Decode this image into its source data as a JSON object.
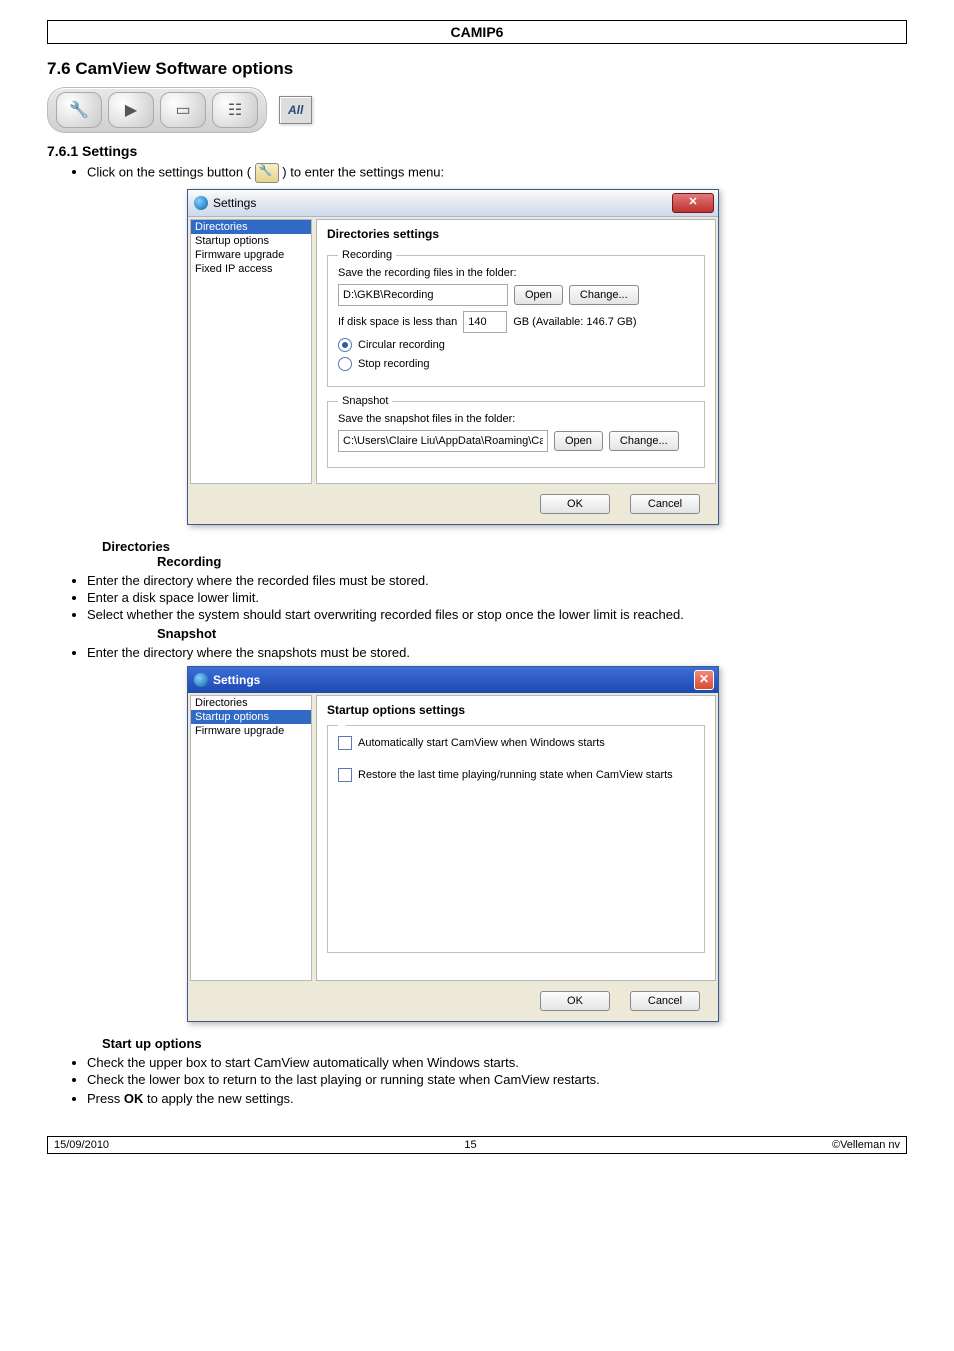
{
  "header": {
    "product": "CAMIP6"
  },
  "section": {
    "title": "7.6 CamView Software options",
    "sub1": "7.6.1 Settings",
    "intro_prefix": "Click on the settings button ( ",
    "intro_suffix": " ) to enter the settings menu:"
  },
  "toolbar": {
    "icons": [
      "wrench-icon",
      "play-icon",
      "window-icon",
      "devices-icon"
    ],
    "all_label": "All"
  },
  "dialog1": {
    "title": "Settings",
    "close": "✕",
    "sidebar": [
      "Directories",
      "Startup options",
      "Firmware upgrade",
      "Fixed IP access"
    ],
    "selected_index": 0,
    "pane_title": "Directories settings",
    "recording": {
      "legend": "Recording",
      "save_label": "Save the recording files in the folder:",
      "path": "D:\\GKB\\Recording",
      "open": "Open",
      "change": "Change...",
      "disk_prefix": "If disk space is less than",
      "disk_value": "140",
      "disk_suffix": "GB (Available: 146.7 GB)",
      "opt_circular": "Circular recording",
      "opt_stop": "Stop recording"
    },
    "snapshot": {
      "legend": "Snapshot",
      "save_label": "Save the snapshot files in the folder:",
      "path": "C:\\Users\\Claire Liu\\AppData\\Roaming\\Ca",
      "open": "Open",
      "change": "Change..."
    },
    "ok": "OK",
    "cancel": "Cancel"
  },
  "desc_dirs": {
    "h": "Directories",
    "rec_h": "Recording",
    "rec_items": [
      "Enter the directory where the recorded files must be stored.",
      "Enter a disk space lower limit.",
      "Select whether the system should start overwriting recorded files or stop once the lower limit is reached."
    ],
    "snap_h": "Snapshot",
    "snap_items": [
      "Enter the directory where the snapshots must be stored."
    ]
  },
  "dialog2": {
    "title": "Settings",
    "close": "✕",
    "sidebar": [
      "Directories",
      "Startup options",
      "Firmware upgrade"
    ],
    "selected_index": 1,
    "pane_title": "Startup options settings",
    "opt1": "Automatically start CamView when Windows starts",
    "opt2": "Restore the last time playing/running state when CamView starts",
    "ok": "OK",
    "cancel": "Cancel"
  },
  "desc_startup": {
    "h": "Start up options",
    "items": [
      "Check the upper box to start CamView automatically when Windows starts.",
      "Check the lower box to return to the last playing or running state when CamView restarts."
    ],
    "press_prefix": "Press ",
    "press_bold": "OK",
    "press_suffix": " to apply the new settings."
  },
  "footer": {
    "date": "15/09/2010",
    "page": "15",
    "copyright": "©Velleman nv"
  }
}
